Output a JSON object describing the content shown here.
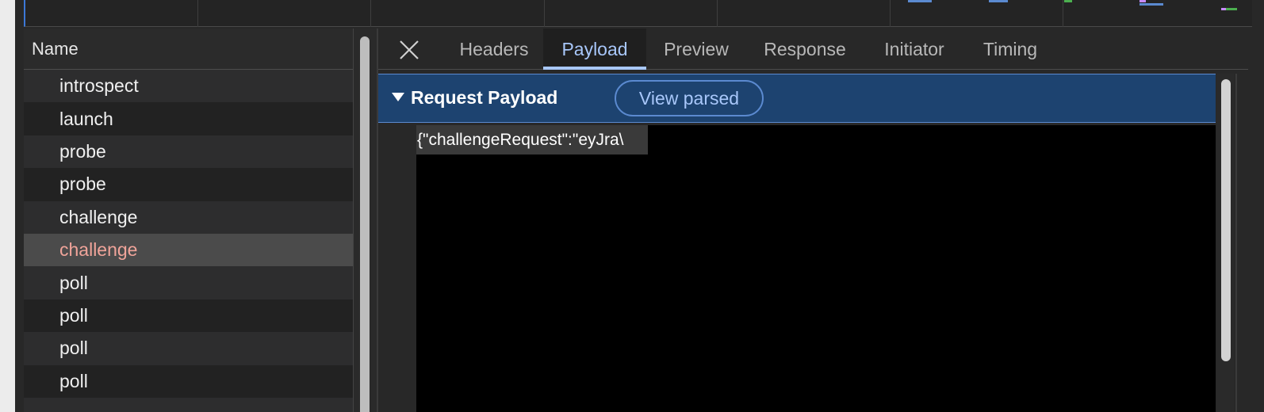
{
  "request_list": {
    "column_header": "Name",
    "rows": [
      {
        "name": "introspect"
      },
      {
        "name": "launch"
      },
      {
        "name": "probe"
      },
      {
        "name": "probe"
      },
      {
        "name": "challenge"
      },
      {
        "name": "challenge",
        "selected": true
      },
      {
        "name": "poll"
      },
      {
        "name": "poll"
      },
      {
        "name": "poll"
      },
      {
        "name": "poll"
      }
    ]
  },
  "details": {
    "close_icon": "close-icon",
    "tabs": [
      {
        "label": "Headers"
      },
      {
        "label": "Payload",
        "active": true
      },
      {
        "label": "Preview"
      },
      {
        "label": "Response"
      },
      {
        "label": "Initiator"
      },
      {
        "label": "Timing"
      }
    ],
    "payload": {
      "section_title": "Request Payload",
      "view_parsed_label": "View parsed",
      "raw_text": "{\"challengeRequest\":\"eyJra\\"
    }
  },
  "colors": {
    "accent": "#a8c7fa",
    "selected_text": "#f0a49a",
    "section_bg": "#1d4370",
    "section_border": "#5b8ad0"
  }
}
